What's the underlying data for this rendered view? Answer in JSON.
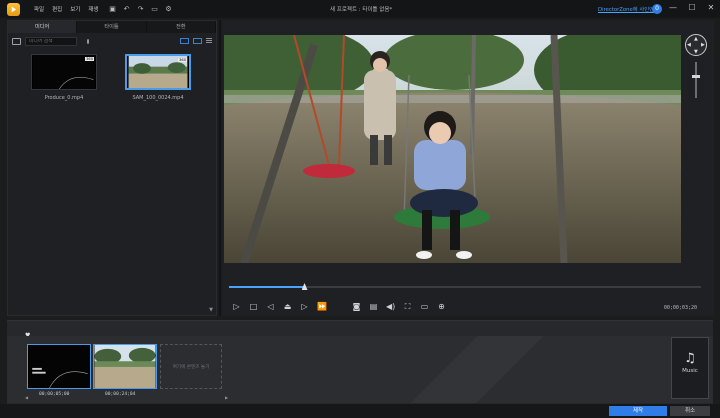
{
  "titlebar": {
    "menu": [
      "파일",
      "편집",
      "보기",
      "재생"
    ],
    "window_title": "새 프로젝트 : 타이틀 없음*",
    "signin_link": "DirectorZone에 사인인",
    "user_initial": "0",
    "window_controls": [
      "—",
      "☐",
      "✕"
    ]
  },
  "library": {
    "tabs": [
      "미디어",
      "타이틀",
      "전환"
    ],
    "search_placeholder": "미디어 검색",
    "items": [
      {
        "name": "Produce_0.mp4",
        "badge": "360"
      },
      {
        "name": "SAM_100_0024.mp4",
        "badge": "360"
      }
    ]
  },
  "preview": {
    "timecode": "00;00;03;20",
    "progress": 0.16
  },
  "timeline": {
    "clips": [
      {
        "timecode": "00;00;05;00"
      },
      {
        "timecode": "00;00;24;04"
      }
    ],
    "placeholder_text": "여기에 콘텐츠 놓기",
    "music_label": "Music"
  },
  "buttons": {
    "produce": "제작",
    "cancel": "취소"
  },
  "colors": {
    "accent": "#2f7ee8",
    "link": "#4aa3ff",
    "background": "#1b1c1e"
  }
}
